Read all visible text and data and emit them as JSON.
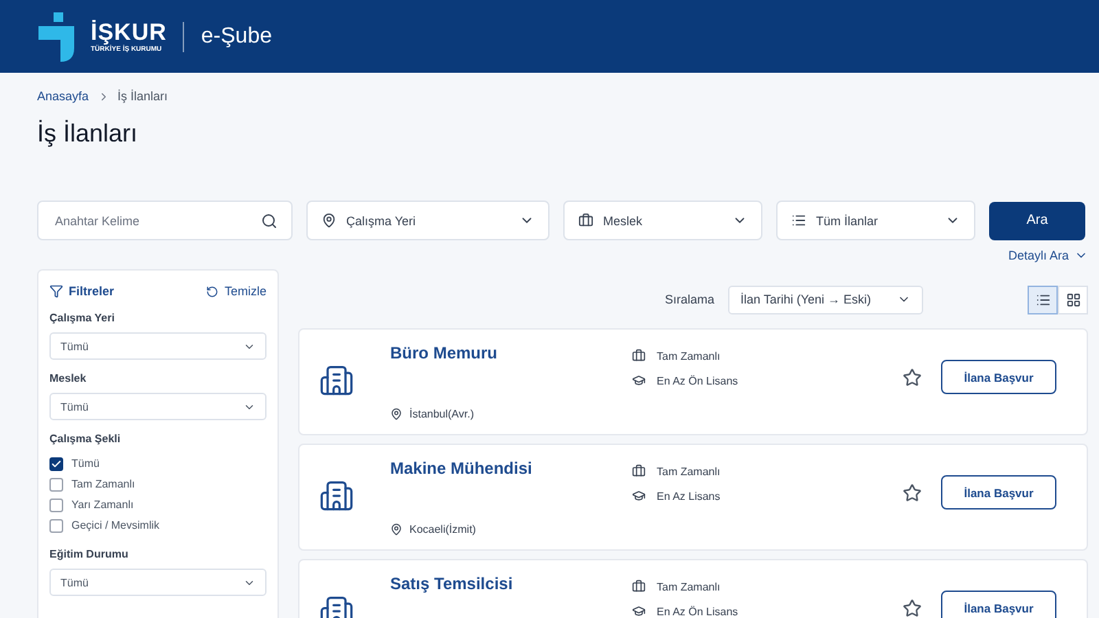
{
  "header": {
    "logo_name": "İŞKUR",
    "logo_subtitle": "TÜRKİYE İŞ KURUMU",
    "app_name": "e-Şube"
  },
  "breadcrumb": [
    "Anasayfa",
    "İş İlanları"
  ],
  "page_title": "İş İlanları",
  "search": {
    "keyword_placeholder": "Anahtar Kelime",
    "location": "Çalışma Yeri",
    "profession": "Meslek",
    "listing_type": "Tüm İlanlar",
    "button": "Ara",
    "advanced": "Detaylı Ara"
  },
  "filters": {
    "title": "Filtreler",
    "clear": "Temizle",
    "groups": [
      {
        "kind": "select",
        "label": "Çalışma Yeri",
        "value": "Tümü"
      },
      {
        "kind": "select",
        "label": "Meslek",
        "value": "Tümü"
      },
      {
        "kind": "checks",
        "label": "Çalışma Şekli",
        "options": [
          {
            "label": "Tümü",
            "checked": true
          },
          {
            "label": "Tam Zamanlı",
            "checked": false
          },
          {
            "label": "Yarı Zamanlı",
            "checked": false
          },
          {
            "label": "Geçici / Mevsimlik",
            "checked": false
          }
        ]
      },
      {
        "kind": "select",
        "label": "Eğitim Durumu",
        "value": "Tümü"
      }
    ]
  },
  "sort": {
    "label": "Sıralama",
    "value": "İlan Tarihi (Yeni → Eski)"
  },
  "view_toggles": [
    {
      "kind": "list",
      "selected": true
    },
    {
      "kind": "grid",
      "selected": false
    }
  ],
  "jobs": [
    {
      "title": "Büro Memuru",
      "type": "Tam Zamanlı",
      "education": "En Az Ön Lisans",
      "location": "İstanbul(Avr.)",
      "button": "İlana Başvur"
    },
    {
      "title": "Makine Mühendisi",
      "type": "Tam Zamanlı",
      "education": "En Az Lisans",
      "location": "Kocaeli(İzmit)",
      "button": "İlana Başvur"
    },
    {
      "title": "Satış Temsilcisi",
      "type": "Tam Zamanlı",
      "education": "En Az Ön Lisans",
      "button": "İlana Başvur"
    }
  ]
}
